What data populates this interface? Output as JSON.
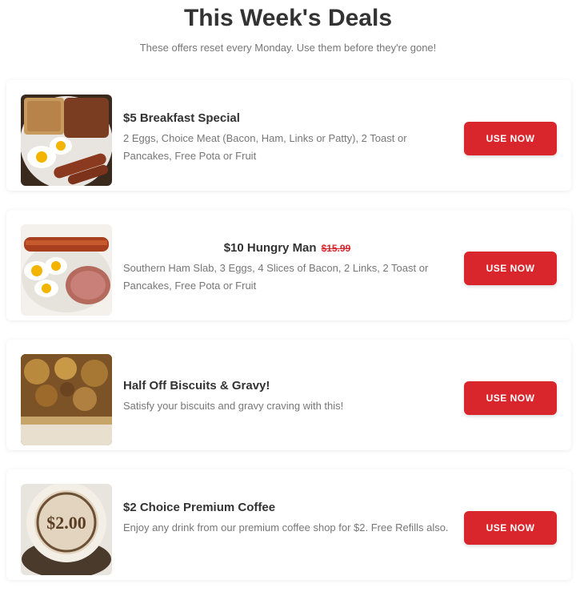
{
  "header": {
    "title": "This Week's Deals",
    "subtitle": "These offers reset every Monday. Use them before they're gone!"
  },
  "deals": [
    {
      "name": "$5 Breakfast Special",
      "description": "2 Eggs, Choice Meat (Bacon, Ham, Links or Patty), 2 Toast or Pancakes, Free Pota or Fruit",
      "button": "USE NOW",
      "image": "breakfast-plate"
    },
    {
      "name": "$10 Hungry Man",
      "old_price": "$15.99",
      "description": "Southern Ham Slab, 3 Eggs, 4 Slices of Bacon, 2 Links, 2 Toast or Pancakes, Free Pota or Fruit",
      "button": "USE NOW",
      "image": "hungry-man-plate"
    },
    {
      "name": "Half Off Biscuits & Gravy!",
      "description": "Satisfy your biscuits and gravy craving with this!",
      "button": "USE NOW",
      "image": "biscuits-gravy"
    },
    {
      "name": "$2 Choice Premium Coffee",
      "description": "Enjoy any drink from our premium coffee shop for $2. Free Refills also.",
      "button": "USE NOW",
      "image": "coffee-cup",
      "image_label": "$2.00"
    }
  ],
  "colors": {
    "accent": "#d9262c",
    "title": "#333333",
    "muted": "#777777"
  }
}
